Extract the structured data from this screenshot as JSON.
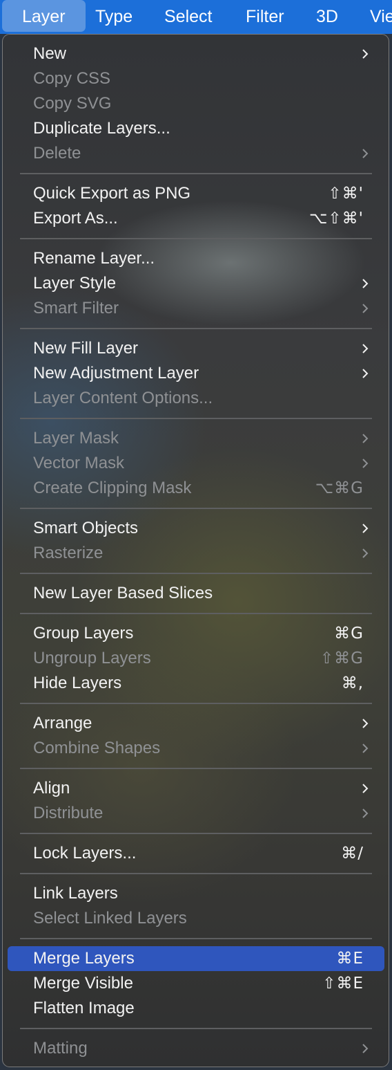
{
  "menubar": {
    "items": [
      {
        "label": "Layer",
        "active": true
      },
      {
        "label": "Type"
      },
      {
        "label": "Select"
      },
      {
        "label": "Filter"
      },
      {
        "label": "3D"
      },
      {
        "label": "Vie"
      }
    ]
  },
  "menu": {
    "items": [
      {
        "label": "New",
        "shortcut": "",
        "submenu": true,
        "disabled": false
      },
      {
        "label": "Copy CSS",
        "shortcut": "",
        "submenu": false,
        "disabled": true
      },
      {
        "label": "Copy SVG",
        "shortcut": "",
        "submenu": false,
        "disabled": true
      },
      {
        "label": "Duplicate Layers...",
        "shortcut": "",
        "submenu": false,
        "disabled": false
      },
      {
        "label": "Delete",
        "shortcut": "",
        "submenu": true,
        "disabled": true
      },
      {
        "label": "Quick Export as PNG",
        "shortcut": "⇧⌘'",
        "submenu": false,
        "disabled": false
      },
      {
        "label": "Export As...",
        "shortcut": "⌥⇧⌘'",
        "submenu": false,
        "disabled": false
      },
      {
        "label": "Rename Layer...",
        "shortcut": "",
        "submenu": false,
        "disabled": false
      },
      {
        "label": "Layer Style",
        "shortcut": "",
        "submenu": true,
        "disabled": false
      },
      {
        "label": "Smart Filter",
        "shortcut": "",
        "submenu": true,
        "disabled": true
      },
      {
        "label": "New Fill Layer",
        "shortcut": "",
        "submenu": true,
        "disabled": false
      },
      {
        "label": "New Adjustment Layer",
        "shortcut": "",
        "submenu": true,
        "disabled": false
      },
      {
        "label": "Layer Content Options...",
        "shortcut": "",
        "submenu": false,
        "disabled": true
      },
      {
        "label": "Layer Mask",
        "shortcut": "",
        "submenu": true,
        "disabled": true
      },
      {
        "label": "Vector Mask",
        "shortcut": "",
        "submenu": true,
        "disabled": true
      },
      {
        "label": "Create Clipping Mask",
        "shortcut": "⌥⌘G",
        "submenu": false,
        "disabled": true
      },
      {
        "label": "Smart Objects",
        "shortcut": "",
        "submenu": true,
        "disabled": false
      },
      {
        "label": "Rasterize",
        "shortcut": "",
        "submenu": true,
        "disabled": true
      },
      {
        "label": "New Layer Based Slices",
        "shortcut": "",
        "submenu": false,
        "disabled": false
      },
      {
        "label": "Group Layers",
        "shortcut": "⌘G",
        "submenu": false,
        "disabled": false
      },
      {
        "label": "Ungroup Layers",
        "shortcut": "⇧⌘G",
        "submenu": false,
        "disabled": true
      },
      {
        "label": "Hide Layers",
        "shortcut": "⌘,",
        "submenu": false,
        "disabled": false
      },
      {
        "label": "Arrange",
        "shortcut": "",
        "submenu": true,
        "disabled": false
      },
      {
        "label": "Combine Shapes",
        "shortcut": "",
        "submenu": true,
        "disabled": true
      },
      {
        "label": "Align",
        "shortcut": "",
        "submenu": true,
        "disabled": false
      },
      {
        "label": "Distribute",
        "shortcut": "",
        "submenu": true,
        "disabled": true
      },
      {
        "label": "Lock Layers...",
        "shortcut": "⌘/",
        "submenu": false,
        "disabled": false
      },
      {
        "label": "Link Layers",
        "shortcut": "",
        "submenu": false,
        "disabled": false
      },
      {
        "label": "Select Linked Layers",
        "shortcut": "",
        "submenu": false,
        "disabled": true
      },
      {
        "label": "Merge Layers",
        "shortcut": "⌘E",
        "submenu": false,
        "disabled": false,
        "highlighted": true
      },
      {
        "label": "Merge Visible",
        "shortcut": "⇧⌘E",
        "submenu": false,
        "disabled": false
      },
      {
        "label": "Flatten Image",
        "shortcut": "",
        "submenu": false,
        "disabled": false
      },
      {
        "label": "Matting",
        "shortcut": "",
        "submenu": true,
        "disabled": true
      }
    ],
    "separators_after_index": [
      4,
      6,
      9,
      12,
      15,
      17,
      18,
      21,
      23,
      25,
      26,
      28,
      31
    ]
  },
  "colors": {
    "menubar_bg": "#1c6fd9",
    "active_menubar_item": "#5b95e0",
    "highlight": "#2f56bd",
    "text_enabled": "#f2f2f2",
    "text_disabled": "#8f9194",
    "separator": "#5e5f61"
  },
  "icons": {
    "submenu_indicator": "chevron-right-icon"
  }
}
